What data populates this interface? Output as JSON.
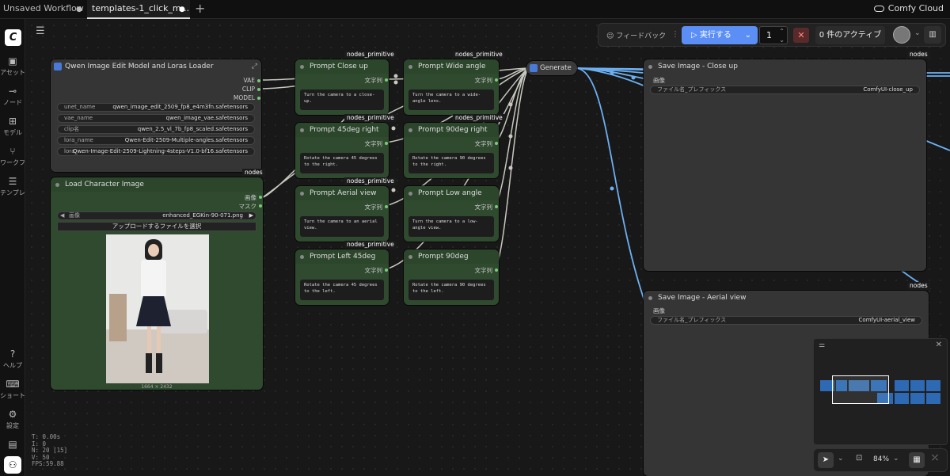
{
  "tabs": [
    {
      "label": "Unsaved Workflow"
    },
    {
      "label": "templates-1_click_m..."
    }
  ],
  "cloud_label": "Comfy Cloud",
  "sidebar": {
    "items": [
      {
        "label": "アセット",
        "icon": "image-icon"
      },
      {
        "label": "ノード",
        "icon": "node-icon"
      },
      {
        "label": "モデル",
        "icon": "model-icon"
      },
      {
        "label": "ワークフロー",
        "icon": "workflow-icon"
      },
      {
        "label": "テンプレート",
        "icon": "template-icon"
      },
      {
        "label": "ヘルプ",
        "icon": "help-icon"
      },
      {
        "label": "ショートカット",
        "icon": "keyboard-icon"
      },
      {
        "label": "設定",
        "icon": "gear-icon"
      }
    ]
  },
  "stats": {
    "t": "T: 0.00s",
    "i": "I: 0",
    "n": "N: 20 [15]",
    "v": "V: 50",
    "fps": "FPS:59.88"
  },
  "toolbar": {
    "feedback": "フィードバック",
    "run": "実行する",
    "count": "1",
    "queue": "0 件のアクティブ"
  },
  "loader_node": {
    "title": "Qwen Image Edit Model and Loras Loader",
    "outputs": [
      "VAE",
      "CLIP",
      "MODEL"
    ],
    "widgets": [
      {
        "label": "unet_name",
        "value": "qwen_image_edit_2509_fp8_e4m3fn.safetensors"
      },
      {
        "label": "vae_name",
        "value": "qwen_image_vae.safetensors"
      },
      {
        "label": "clip名",
        "value": "qwen_2.5_vl_7b_fp8_scaled.safetensors"
      },
      {
        "label": "lora_name",
        "value": "Qwen-Edit-2509-Multiple-angles.safetensors"
      },
      {
        "label": "lora_...",
        "value": "Qwen-Image-Edit-2509-Lightning-4steps-V1.0-bf16.safetensors"
      }
    ],
    "badge": "nodes"
  },
  "load_image_node": {
    "title": "Load Character Image",
    "outputs": [
      "画像",
      "マスク"
    ],
    "image_label": "画像",
    "image_value": "enhanced_EGKin-90-071.png",
    "upload_label": "アップロードするファイルを選択",
    "size": "1664 × 2432"
  },
  "prompt_nodes": [
    {
      "title": "Prompt Close up",
      "text": "Turn the camera to a close-up.",
      "badge": "nodes_primitive",
      "out": "文字列"
    },
    {
      "title": "Prompt Wide angle",
      "text": "Turn the camera to a wide-angle lens.",
      "badge": "nodes_primitive",
      "out": "文字列"
    },
    {
      "title": "Prompt 45deg right",
      "text": "Rotate the camera 45 degrees to the right.",
      "badge": "nodes_primitive",
      "out": "文字列"
    },
    {
      "title": "Prompt 90deg right",
      "text": "Rotate the camera 90 degrees to the right.",
      "badge": "nodes_primitive",
      "out": "文字列"
    },
    {
      "title": "Prompt Aerial view",
      "text": "Turn the camera to an aerial view.",
      "badge": "nodes_primitive",
      "out": "文字列"
    },
    {
      "title": "Prompt Low angle",
      "text": "Turn the camera to a low-angle view.",
      "badge": "nodes_primitive",
      "out": "文字列"
    },
    {
      "title": "Prompt Left 45deg",
      "text": "Rotate the camera 45 degrees to the left.",
      "badge": "nodes_primitive",
      "out": "文字列"
    },
    {
      "title": "Prompt 90deg",
      "text": "Rotate the camera 90 degrees to the left.",
      "badge": "nodes_primitive",
      "out": "文字列"
    }
  ],
  "generate_node": {
    "title": "Generate"
  },
  "save_nodes": [
    {
      "title": "Save Image - Close up",
      "input": "画像",
      "prefix_label": "ファイル名_プレフィックス",
      "prefix_value": "ComfyUI-close_up",
      "badge": "nodes"
    },
    {
      "title": "Save Image - Aerial view",
      "input": "画像",
      "prefix_label": "ファイル名_プレフィックス",
      "prefix_value": "ComfyUI-aerial_view",
      "badge": "nodes"
    }
  ],
  "zoom": "84%",
  "colors": {
    "accent": "#5b8ff5",
    "wire_image": "#6cb0f2",
    "wire_string": "#c8c8c0",
    "node_green": "#2f4a2f"
  }
}
